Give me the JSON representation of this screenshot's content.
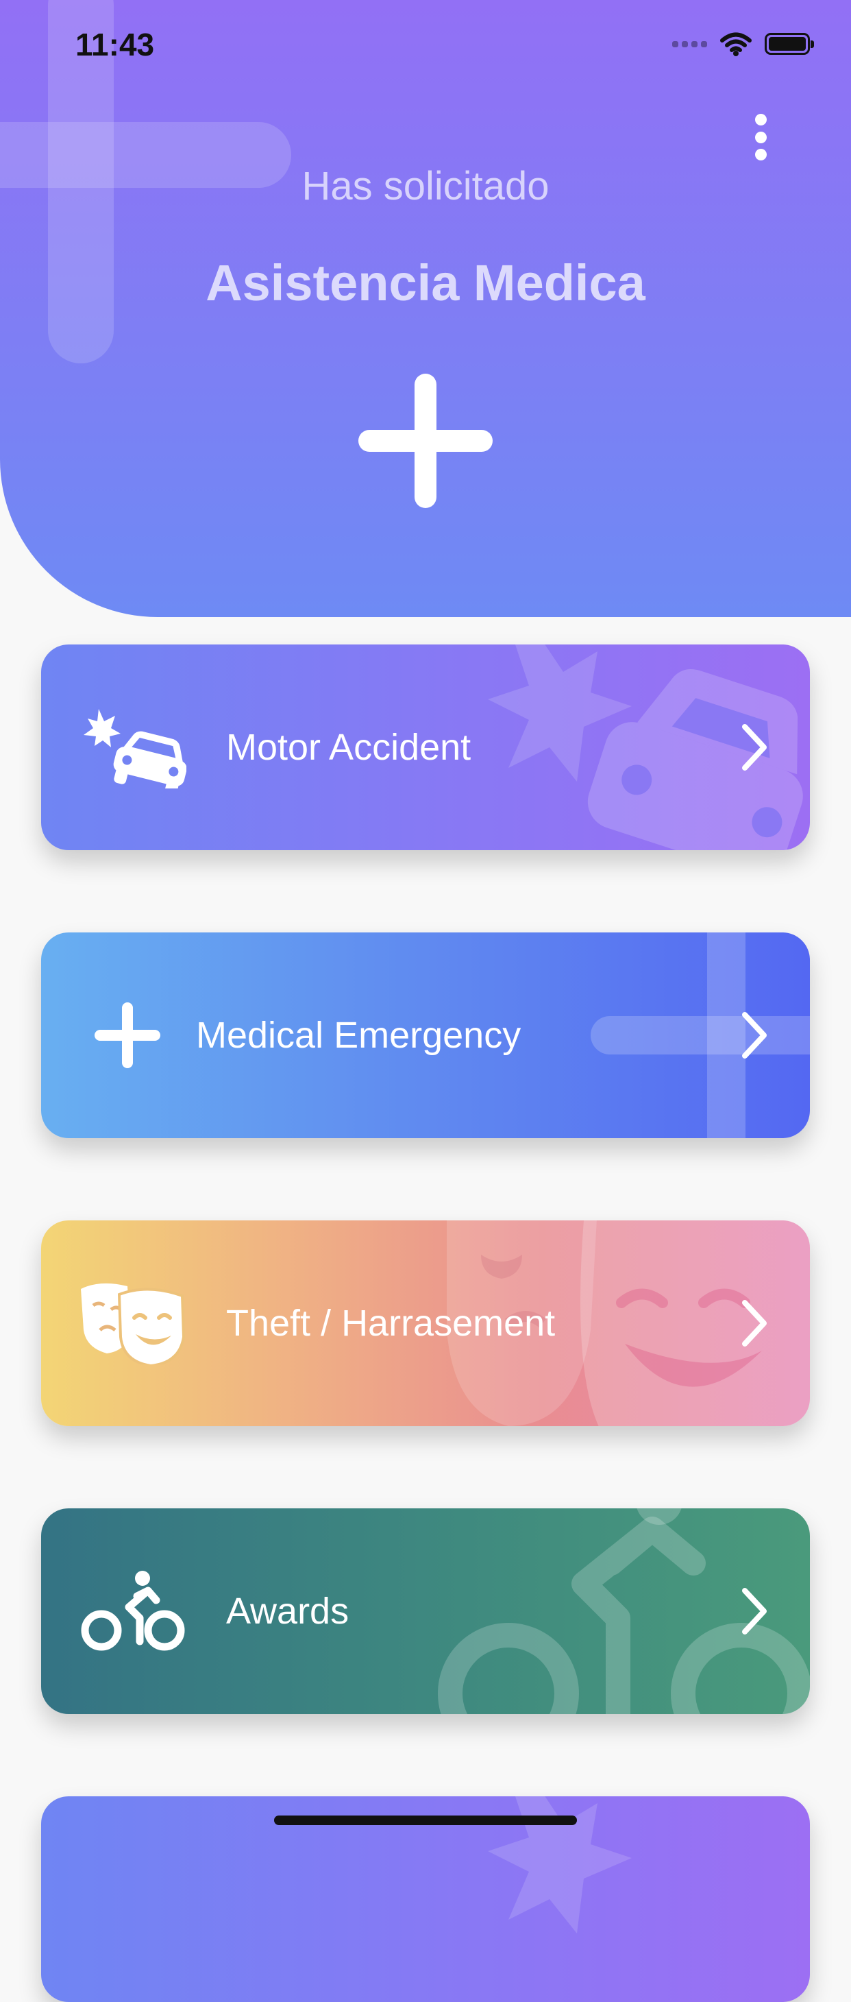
{
  "status_bar": {
    "time": "11:43"
  },
  "header": {
    "subtitle": "Has solicitado",
    "title": "Asistencia Medica",
    "add_icon": "plus-icon",
    "menu_icon": "more-vertical-icon"
  },
  "cards": [
    {
      "label": "Motor Accident",
      "icon": "car-crash-icon",
      "colors": [
        "#6f85f3",
        "#9c6ff3"
      ]
    },
    {
      "label": "Medical Emergency",
      "icon": "plus-icon",
      "colors": [
        "#68aff1",
        "#5468f2"
      ]
    },
    {
      "label": "Theft / Harrasement",
      "icon": "theater-masks-icon",
      "colors": [
        "#f3d575",
        "#e789b5"
      ]
    },
    {
      "label": "Awards",
      "icon": "cyclist-icon",
      "colors": [
        "#347384",
        "#4a9a7c"
      ]
    },
    {
      "label": "",
      "icon": "car-crash-icon",
      "colors": [
        "#6f85f3",
        "#9c6ff3"
      ]
    }
  ]
}
